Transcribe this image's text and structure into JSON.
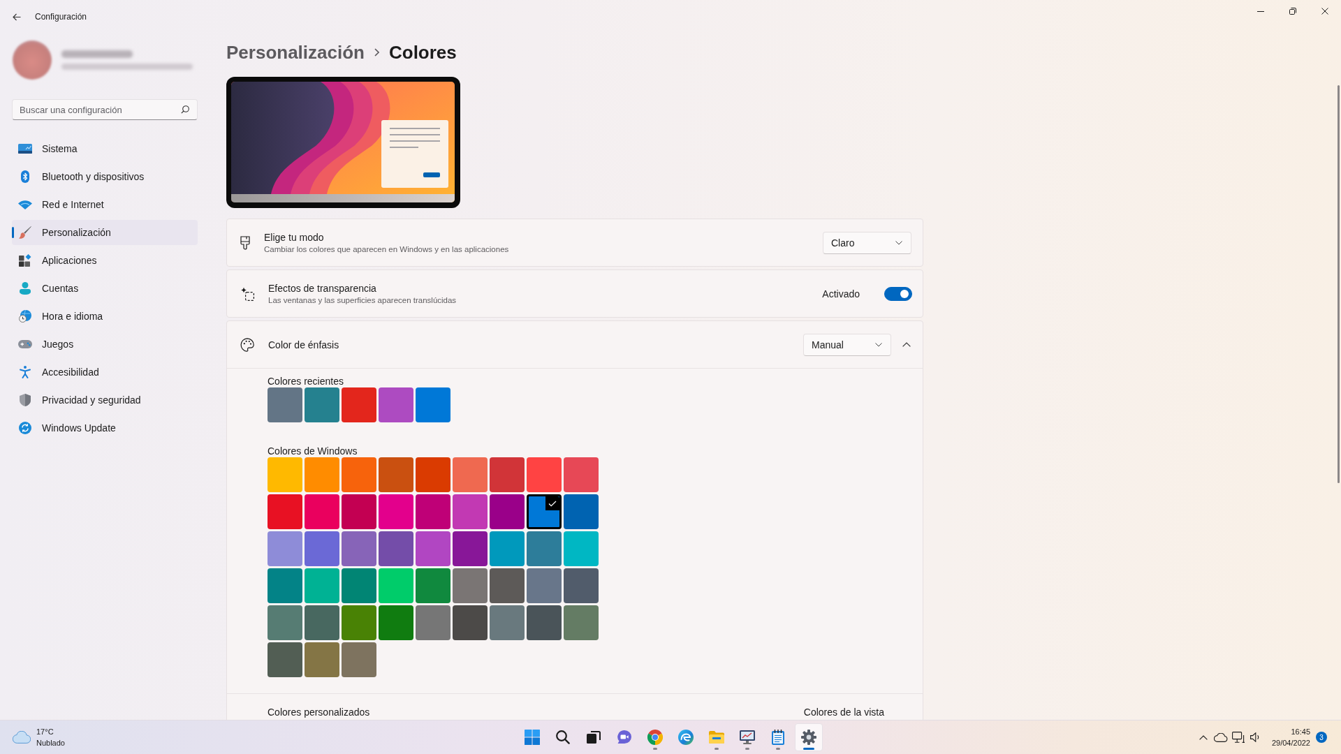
{
  "window": {
    "title": "Configuración"
  },
  "sidebar": {
    "search": {
      "placeholder": "Buscar una configuración"
    },
    "items": [
      {
        "label": "Sistema",
        "selected": false
      },
      {
        "label": "Bluetooth y dispositivos",
        "selected": false
      },
      {
        "label": "Red e Internet",
        "selected": false
      },
      {
        "label": "Personalización",
        "selected": true
      },
      {
        "label": "Aplicaciones",
        "selected": false
      },
      {
        "label": "Cuentas",
        "selected": false
      },
      {
        "label": "Hora e idioma",
        "selected": false
      },
      {
        "label": "Juegos",
        "selected": false
      },
      {
        "label": "Accesibilidad",
        "selected": false
      },
      {
        "label": "Privacidad y seguridad",
        "selected": false
      },
      {
        "label": "Windows Update",
        "selected": false
      }
    ]
  },
  "breadcrumb": {
    "parent": "Personalización",
    "current": "Colores"
  },
  "settings": [
    {
      "kind": "dropdown",
      "title": "Elige tu modo",
      "description": "Cambiar los colores que aparecen en Windows y en las aplicaciones",
      "value": "Claro"
    },
    {
      "kind": "toggle",
      "title": "Efectos de transparencia",
      "description": "Las ventanas y las superficies aparecen translúcidas",
      "state_label": "Activado",
      "on": true
    },
    {
      "kind": "expander",
      "title": "Color de énfasis",
      "value": "Manual",
      "expanded": true,
      "panel": {
        "recent": {
          "title": "Colores recientes",
          "colors": [
            {
              "color": "#637586"
            },
            {
              "color": "#25818f"
            },
            {
              "color": "#e3261c"
            },
            {
              "color": "#ad4bc1"
            },
            {
              "color": "#0078d7"
            }
          ]
        },
        "windows": {
          "title": "Colores de Windows",
          "colors": [
            {
              "color": "#ffb900",
              "selected": false
            },
            {
              "color": "#ff8c00",
              "selected": false
            },
            {
              "color": "#f7630c",
              "selected": false
            },
            {
              "color": "#ca5010",
              "selected": false
            },
            {
              "color": "#da3b01",
              "selected": false
            },
            {
              "color": "#ef6950",
              "selected": false
            },
            {
              "color": "#d13438",
              "selected": false
            },
            {
              "color": "#ff4343",
              "selected": false
            },
            {
              "color": "#e74856",
              "selected": false
            },
            {
              "color": "#e81123",
              "selected": false
            },
            {
              "color": "#ea005e",
              "selected": false
            },
            {
              "color": "#c30052",
              "selected": false
            },
            {
              "color": "#e3008c",
              "selected": false
            },
            {
              "color": "#bf0077",
              "selected": false
            },
            {
              "color": "#c239b3",
              "selected": false
            },
            {
              "color": "#9a0089",
              "selected": false
            },
            {
              "color": "#0078d7",
              "selected": true
            },
            {
              "color": "#0063b1",
              "selected": false
            },
            {
              "color": "#8e8cd8",
              "selected": false
            },
            {
              "color": "#6b69d6",
              "selected": false
            },
            {
              "color": "#8764b8",
              "selected": false
            },
            {
              "color": "#744da9",
              "selected": false
            },
            {
              "color": "#b146c2",
              "selected": false
            },
            {
              "color": "#881798",
              "selected": false
            },
            {
              "color": "#0099bc",
              "selected": false
            },
            {
              "color": "#2d7d9a",
              "selected": false
            },
            {
              "color": "#00b7c3",
              "selected": false
            },
            {
              "color": "#038387",
              "selected": false
            },
            {
              "color": "#00b294",
              "selected": false
            },
            {
              "color": "#018574",
              "selected": false
            },
            {
              "color": "#00cc6a",
              "selected": false
            },
            {
              "color": "#10893e",
              "selected": false
            },
            {
              "color": "#7a7574",
              "selected": false
            },
            {
              "color": "#5d5a58",
              "selected": false
            },
            {
              "color": "#68768a",
              "selected": false
            },
            {
              "color": "#515c6b",
              "selected": false
            },
            {
              "color": "#567c73",
              "selected": false
            },
            {
              "color": "#486860",
              "selected": false
            },
            {
              "color": "#498205",
              "selected": false
            },
            {
              "color": "#107c10",
              "selected": false
            },
            {
              "color": "#767676",
              "selected": false
            },
            {
              "color": "#4c4a48",
              "selected": false
            },
            {
              "color": "#69797e",
              "selected": false
            },
            {
              "color": "#4a5459",
              "selected": false
            },
            {
              "color": "#647c64",
              "selected": false
            },
            {
              "color": "#525e54",
              "selected": false
            },
            {
              "color": "#847545",
              "selected": false
            },
            {
              "color": "#7e735f",
              "selected": false
            }
          ]
        },
        "custom": {
          "title": "Colores personalizados",
          "button": "Colores de la vista"
        }
      }
    }
  ],
  "taskbar": {
    "weather": {
      "temperature": "17°C",
      "condition": "Nublado"
    },
    "apps": [
      {
        "running": false,
        "active": false
      },
      {
        "running": false,
        "active": false
      },
      {
        "running": false,
        "active": false
      },
      {
        "running": false,
        "active": false
      },
      {
        "running": true,
        "active": false
      },
      {
        "running": false,
        "active": false
      },
      {
        "running": true,
        "active": false
      },
      {
        "running": true,
        "active": false
      },
      {
        "running": true,
        "active": false
      },
      {
        "running": true,
        "active": true
      }
    ],
    "clock": {
      "time": "16:45",
      "date": "29/04/2022"
    },
    "notifications": "3"
  }
}
